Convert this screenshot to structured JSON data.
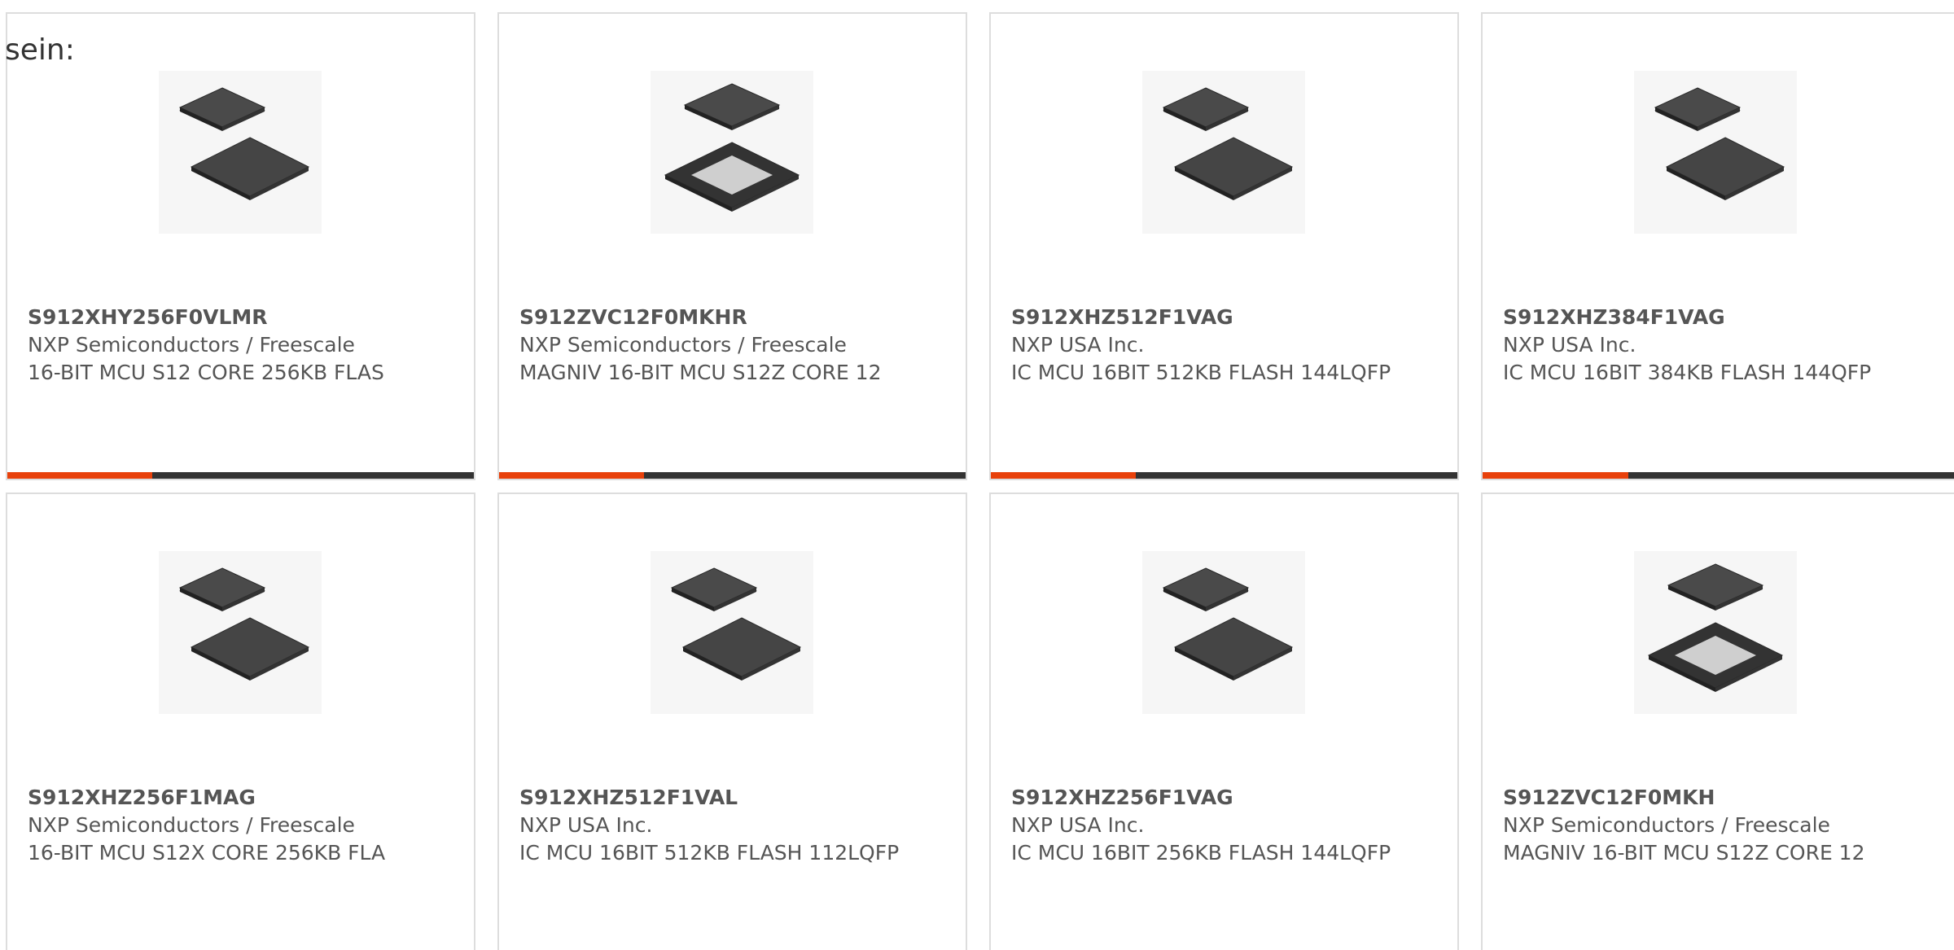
{
  "intro_text": "sein:",
  "colors": {
    "accent": "#e8410b",
    "bar_track": "#333333",
    "card_border": "#dddddd",
    "text": "#555555"
  },
  "cards": [
    {
      "part_number": "S912XHY256F0VLMR",
      "manufacturer": "NXP Semiconductors / Freescale",
      "description": "16-BIT MCU S12 CORE 256KB FLAS",
      "image_icon": "chip-package-icon",
      "progress_fraction": 0.31
    },
    {
      "part_number": "S912ZVC12F0MKHR",
      "manufacturer": "NXP Semiconductors / Freescale",
      "description": "MAGNIV 16-BIT MCU S12Z CORE 12",
      "image_icon": "chip-package-exploded-icon",
      "progress_fraction": 0.31
    },
    {
      "part_number": "S912XHZ512F1VAG",
      "manufacturer": "NXP USA Inc.",
      "description": "IC MCU 16BIT 512KB FLASH 144LQFP",
      "image_icon": "chip-package-icon",
      "progress_fraction": 0.31
    },
    {
      "part_number": "S912XHZ384F1VAG",
      "manufacturer": "NXP USA Inc.",
      "description": "IC MCU 16BIT 384KB FLASH 144QFP",
      "image_icon": "chip-package-icon",
      "progress_fraction": 0.31
    },
    {
      "part_number": "S912XHZ256F1MAG",
      "manufacturer": "NXP Semiconductors / Freescale",
      "description": "16-BIT MCU S12X CORE 256KB FLA",
      "image_icon": "chip-package-icon",
      "progress_fraction": 0
    },
    {
      "part_number": "S912XHZ512F1VAL",
      "manufacturer": "NXP USA Inc.",
      "description": "IC MCU 16BIT 512KB FLASH 112LQFP",
      "image_icon": "chip-package-icon",
      "progress_fraction": 0
    },
    {
      "part_number": "S912XHZ256F1VAG",
      "manufacturer": "NXP USA Inc.",
      "description": "IC MCU 16BIT 256KB FLASH 144LQFP",
      "image_icon": "chip-package-icon",
      "progress_fraction": 0
    },
    {
      "part_number": "S912ZVC12F0MKH",
      "manufacturer": "NXP Semiconductors / Freescale",
      "description": "MAGNIV 16-BIT MCU S12Z CORE 12",
      "image_icon": "chip-package-exploded-icon",
      "progress_fraction": 0
    }
  ]
}
